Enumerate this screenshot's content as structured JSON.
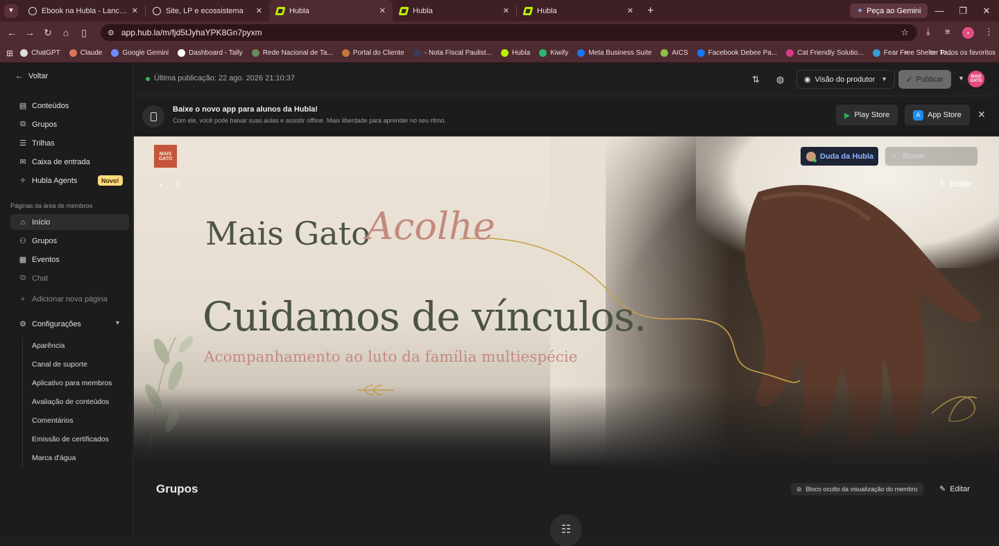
{
  "browser": {
    "tabs": [
      {
        "title": "Ebook na Hubla - Lancamento",
        "icon": "chatgpt-icon",
        "active": false
      },
      {
        "title": "Site, LP e ecossistema",
        "icon": "chatgpt-icon",
        "active": false
      },
      {
        "title": "Hubla",
        "icon": "hubla-icon",
        "active": true
      },
      {
        "title": "Hubla",
        "icon": "hubla-icon",
        "active": false
      },
      {
        "title": "Hubla",
        "icon": "hubla-icon",
        "active": false
      }
    ],
    "gemini_label": "Peça ao Gemini",
    "url": "app.hub.la/m/fjd5tJyhaYPK8Gn7pyxm",
    "bookmarks": [
      {
        "label": "ChatGPT",
        "color": "#dddddd"
      },
      {
        "label": "Claude",
        "color": "#d97757"
      },
      {
        "label": "Google Gemini",
        "color": "#6f8cff"
      },
      {
        "label": "Dashboard - Tally",
        "color": "#ffffff"
      },
      {
        "label": "Rede Nacional de Ta...",
        "color": "#6b8a5a"
      },
      {
        "label": "Portal do Cliente",
        "color": "#c6783a"
      },
      {
        "label": "- Nota Fiscal Paulist...",
        "color": "#3a3a5a"
      },
      {
        "label": "Hubla",
        "color": "#b8f000"
      },
      {
        "label": "Kiwify",
        "color": "#2bb673"
      },
      {
        "label": "Meta Business Suite",
        "color": "#1877f2"
      },
      {
        "label": "AICS",
        "color": "#8bbf4a"
      },
      {
        "label": "Facebook Debee Pa...",
        "color": "#1877f2"
      },
      {
        "label": "Cat Friendly Solutio...",
        "color": "#d63a8a"
      },
      {
        "label": "Fear Free Shelter Pr...",
        "color": "#3a9ad6"
      }
    ],
    "bookmarks_all": "Todos os favoritos"
  },
  "sidebar": {
    "back_label": "Voltar",
    "main_items": [
      {
        "label": "Conteúdos",
        "icon": "book-icon"
      },
      {
        "label": "Grupos",
        "icon": "chat-bubbles-icon"
      },
      {
        "label": "Trilhas",
        "icon": "list-icon"
      },
      {
        "label": "Caixa de entrada",
        "icon": "inbox-icon"
      },
      {
        "label": "Hubla Agents",
        "icon": "sparkle-icon",
        "badge": "Novo!"
      }
    ],
    "section_label": "Páginas da área de membros",
    "page_items": [
      {
        "label": "Início",
        "icon": "home-icon"
      },
      {
        "label": "Grupos",
        "icon": "users-icon"
      },
      {
        "label": "Eventos",
        "icon": "calendar-icon"
      },
      {
        "label": "Chat",
        "icon": "chat-icon"
      }
    ],
    "add_page_label": "Adicionar nova página",
    "settings_label": "Configurações",
    "settings_items": [
      "Aparência",
      "Canal de suporte",
      "Aplicativo para membros",
      "Avaliação de conteúdos",
      "Comentários",
      "Emissão de certificados",
      "Marca d'água"
    ]
  },
  "topbar": {
    "publication_text": "Última publicação: 22 ago. 2026 21:10:37",
    "view_select": "Visão do produtor",
    "publish_label": "Publicar",
    "avatar_text": "MAIS GATO"
  },
  "app_banner": {
    "title": "Baixe o novo app para alunos da Hubla!",
    "subtitle": "Com ele, você pode baixar suas aulas e assistir offline. Mais liberdade para aprender no seu ritmo.",
    "play_store": "Play Store",
    "app_store": "App Store"
  },
  "hero": {
    "logo_text": "MAIS GATO",
    "user_chip": "Duda da Hubla",
    "search_placeholder": "Buscar...",
    "edit_label": "Editar",
    "brand_line": "Mais Gato",
    "brand_script": "Acolhe",
    "headline": "Cuidamos de vínculos.",
    "subheadline": "Acompanhamento ao luto da família multiespécie"
  },
  "grupos_section": {
    "title": "Grupos",
    "hidden_badge": "Bloco oculto da visualização do membro",
    "edit_label": "Editar"
  },
  "colors": {
    "tabbar": "#3d1f24",
    "toolbar": "#4e2a31",
    "sidebar": "#1c1c1c",
    "hero_green": "#4b5440",
    "hero_rose": "#c48a7e",
    "accent_gold": "#c9a24a"
  }
}
